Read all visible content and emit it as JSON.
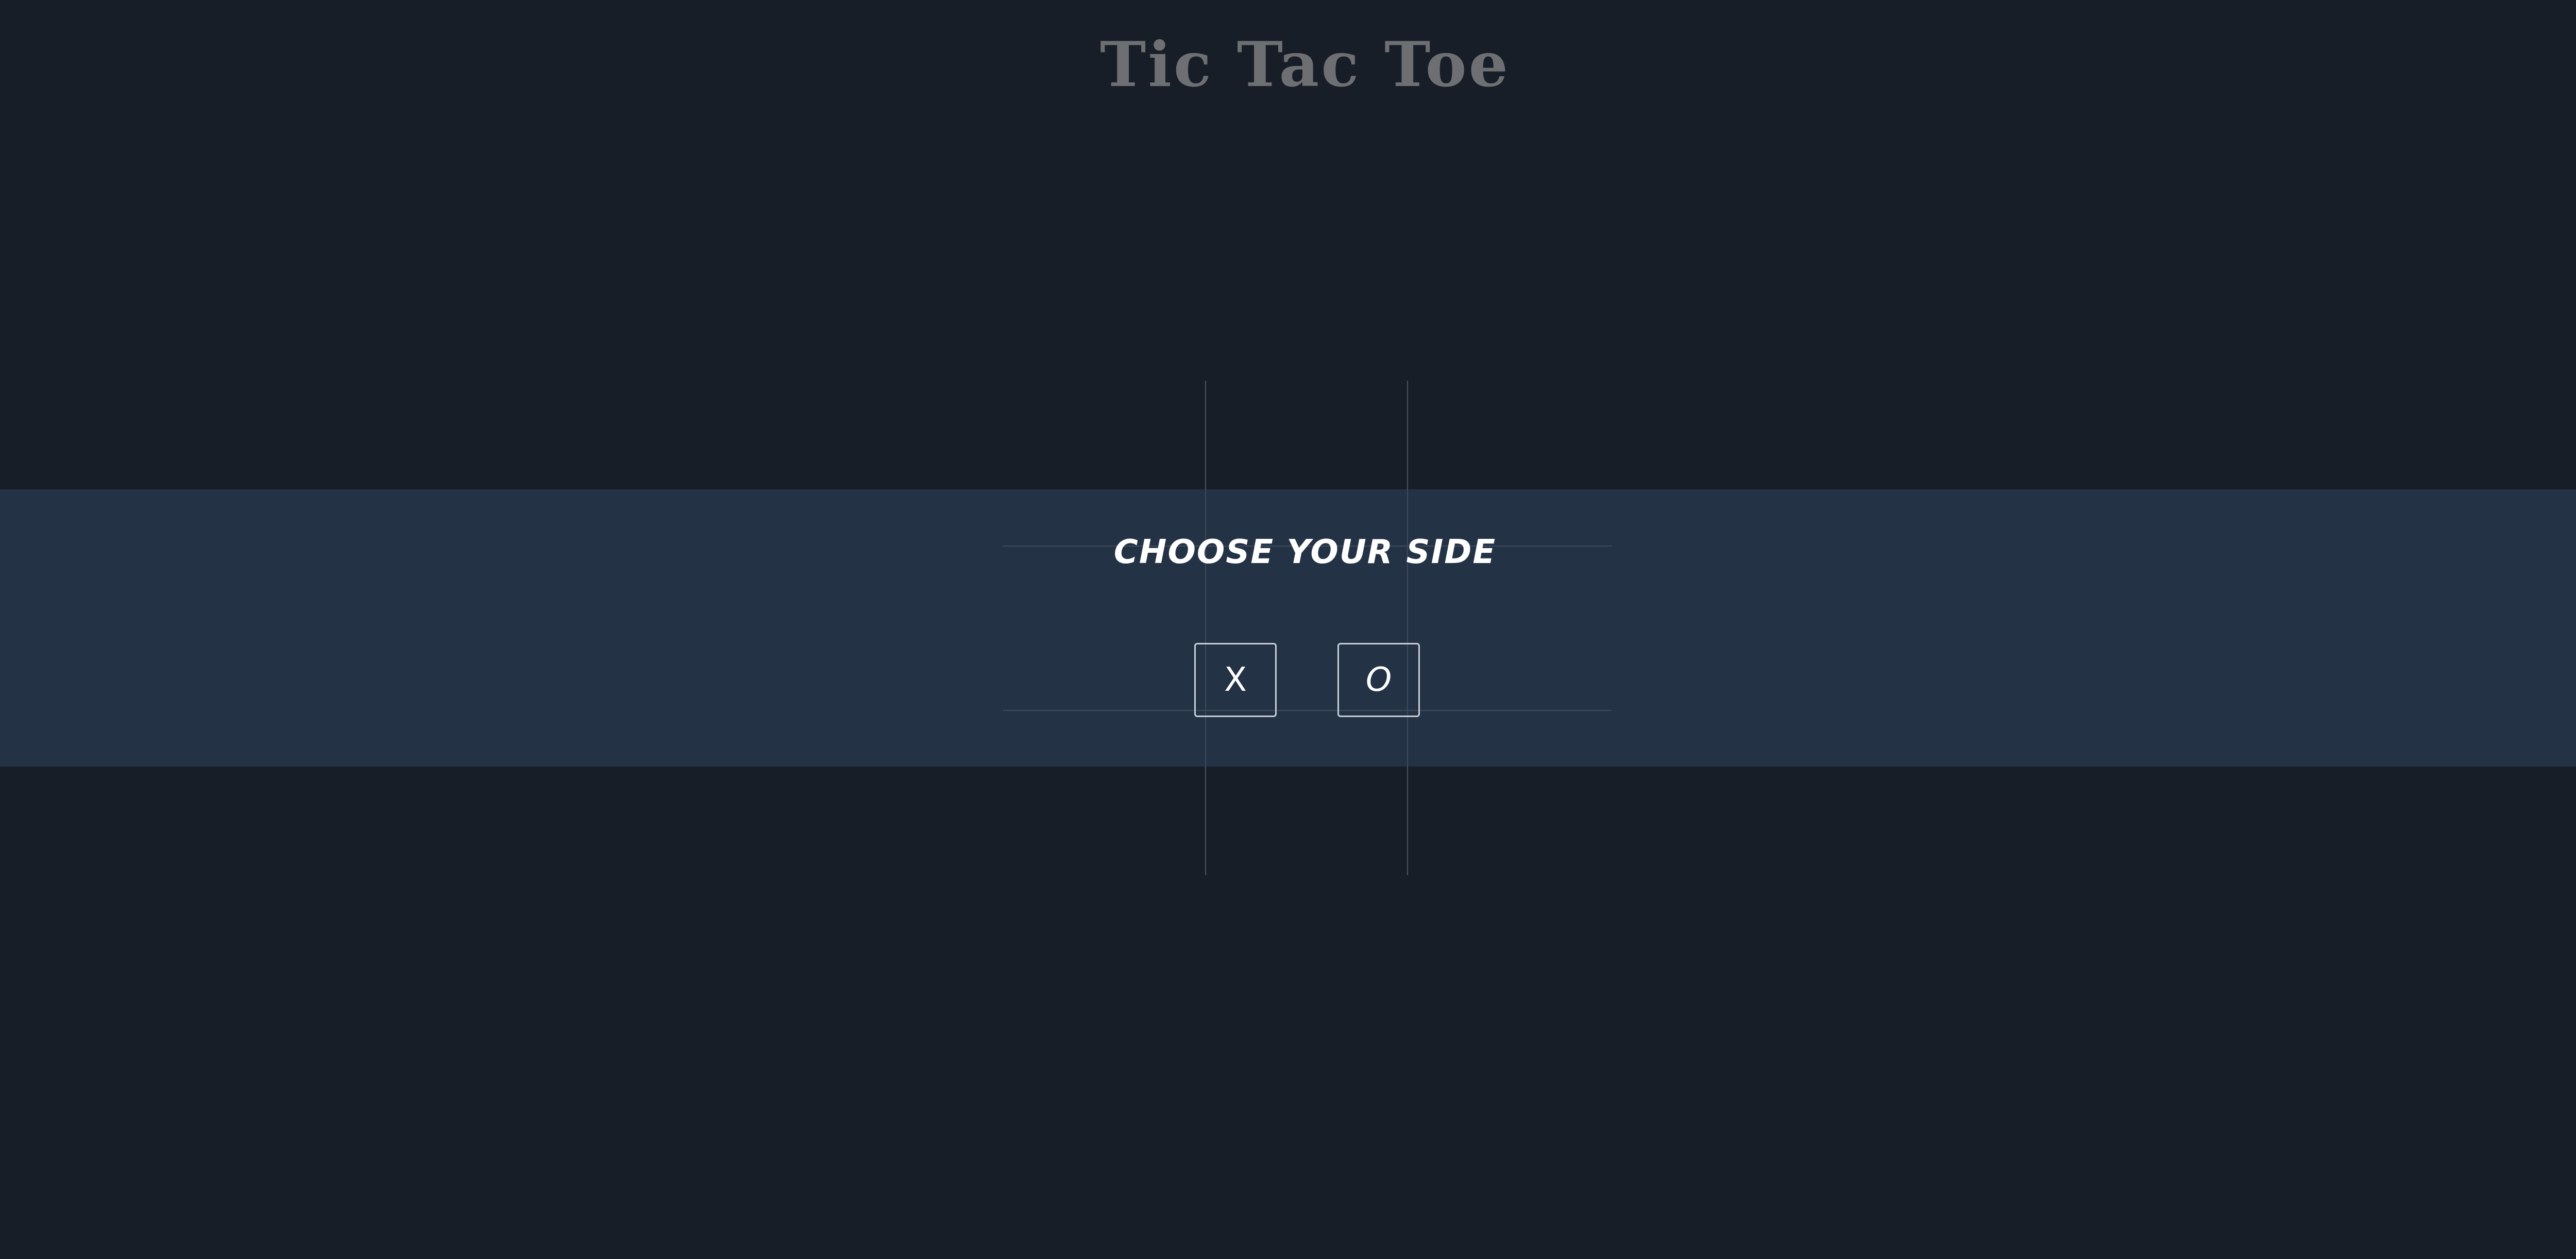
{
  "header": {
    "title": "Tic Tac Toe"
  },
  "board": {
    "rows": 3,
    "columns": 3
  },
  "side_selector": {
    "heading": "CHOOSE YOUR SIDE",
    "options": [
      {
        "label": "X"
      },
      {
        "label": "O"
      }
    ]
  },
  "colors": {
    "background": "#181e27",
    "overlay": "#243447",
    "title_text": "#6d6f73",
    "grid_lines": "#4a5260",
    "button_border": "#c9ced6",
    "text": "#ffffff"
  }
}
